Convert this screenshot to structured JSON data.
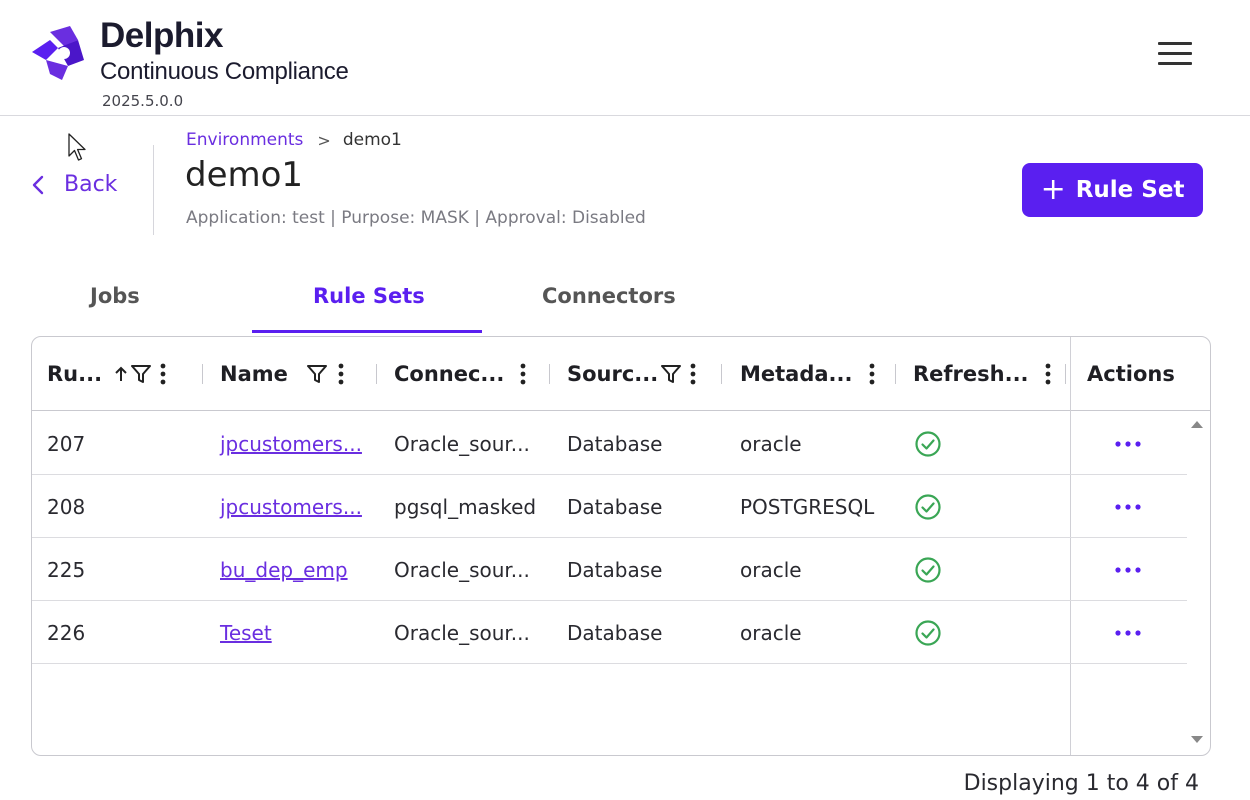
{
  "header": {
    "brand_name": "Delphix",
    "brand_subtitle": "Continuous Compliance",
    "version": "2025.5.0.0"
  },
  "nav": {
    "back_label": "Back",
    "breadcrumb": {
      "parent": "Environments",
      "separator": ">",
      "current": "demo1"
    }
  },
  "page": {
    "title": "demo1",
    "meta": "Application: test | Purpose: MASK | Approval: Disabled",
    "add_button_label": "Rule Set"
  },
  "tabs": [
    {
      "label": "Jobs",
      "active": false
    },
    {
      "label": "Rule Sets",
      "active": true
    },
    {
      "label": "Connectors",
      "active": false
    }
  ],
  "table": {
    "columns": [
      "Ru...",
      "Name",
      "Connec...",
      "Sourc...",
      "Metada...",
      "Refresh...",
      "Actions"
    ],
    "rows": [
      {
        "id": "207",
        "name": "jpcustomers...",
        "connector": "Oracle_sour...",
        "source": "Database",
        "metadata": "oracle",
        "refresh": "success"
      },
      {
        "id": "208",
        "name": "jpcustomers...",
        "connector": "pgsql_masked",
        "source": "Database",
        "metadata": "POSTGRESQL",
        "refresh": "success"
      },
      {
        "id": "225",
        "name": "bu_dep_emp",
        "connector": "Oracle_sour...",
        "source": "Database",
        "metadata": "oracle",
        "refresh": "success"
      },
      {
        "id": "226",
        "name": "Teset",
        "connector": "Oracle_sour...",
        "source": "Database",
        "metadata": "oracle",
        "refresh": "success"
      }
    ],
    "footer": "Displaying 1 to 4 of 4"
  },
  "colors": {
    "accent": "#5a1ff0",
    "link": "#6a2ee0",
    "success": "#3aa655"
  }
}
